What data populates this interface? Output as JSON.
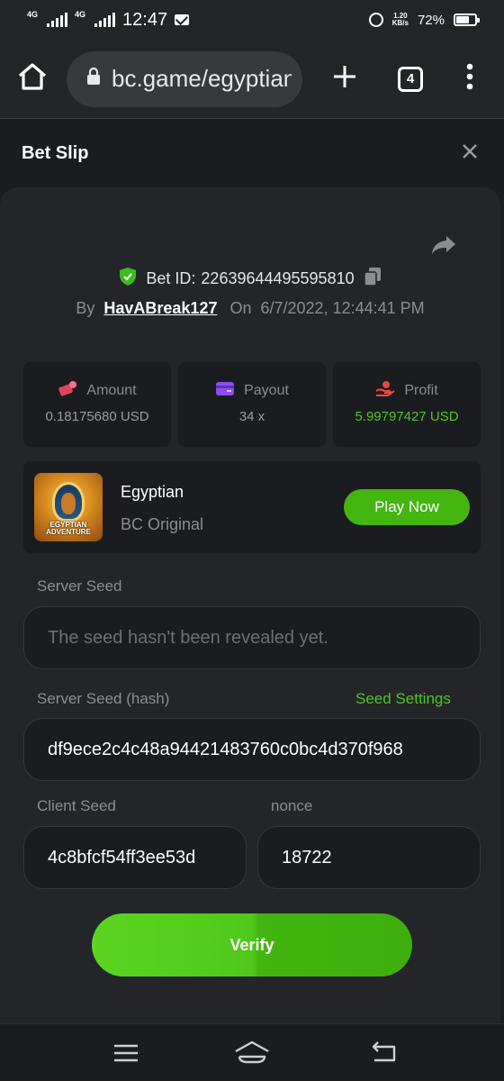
{
  "status_bar": {
    "network_1": "4G",
    "network_2": "4G",
    "time": "12:47",
    "speed_value": "1.20",
    "speed_unit": "KB/s",
    "battery": "72%",
    "battery_level": 0.72
  },
  "browser": {
    "url": "bc.game/egyptian",
    "tab_count": "4"
  },
  "bet_slip": {
    "title": "Bet Slip",
    "bet_id_label": "Bet ID:",
    "bet_id": "22639644495595810",
    "by_label": "By",
    "username": "HavABreak127",
    "on_label": "On",
    "datetime": "6/7/2022, 12:44:41 PM",
    "stats": [
      {
        "label": "Amount",
        "value": "0.18175680 USD",
        "icon": "amount-icon"
      },
      {
        "label": "Payout",
        "value": "34 x",
        "icon": "wallet-icon"
      },
      {
        "label": "Profit",
        "value": "5.99797427 USD",
        "icon": "profit-icon"
      }
    ],
    "game": {
      "name": "Egyptian",
      "provider": "BC Original",
      "thumb_caption": "EGYPTIAN ADVENTURE",
      "play_label": "Play Now"
    },
    "server_seed": {
      "label": "Server Seed",
      "placeholder": "The seed hasn't been revealed yet."
    },
    "server_seed_hash": {
      "label": "Server Seed (hash)",
      "link": "Seed Settings",
      "value": "df9ece2c4c48a94421483760c0bc4d370f968"
    },
    "client_seed": {
      "label": "Client Seed",
      "value": "4c8bfcf54ff3ee53d"
    },
    "nonce": {
      "label": "nonce",
      "value": "18722"
    },
    "verify_label": "Verify"
  },
  "colors": {
    "accent_green": "#44b610",
    "profit_green": "#4ec51d",
    "background": "#1a1c1f",
    "panel": "#232529"
  }
}
